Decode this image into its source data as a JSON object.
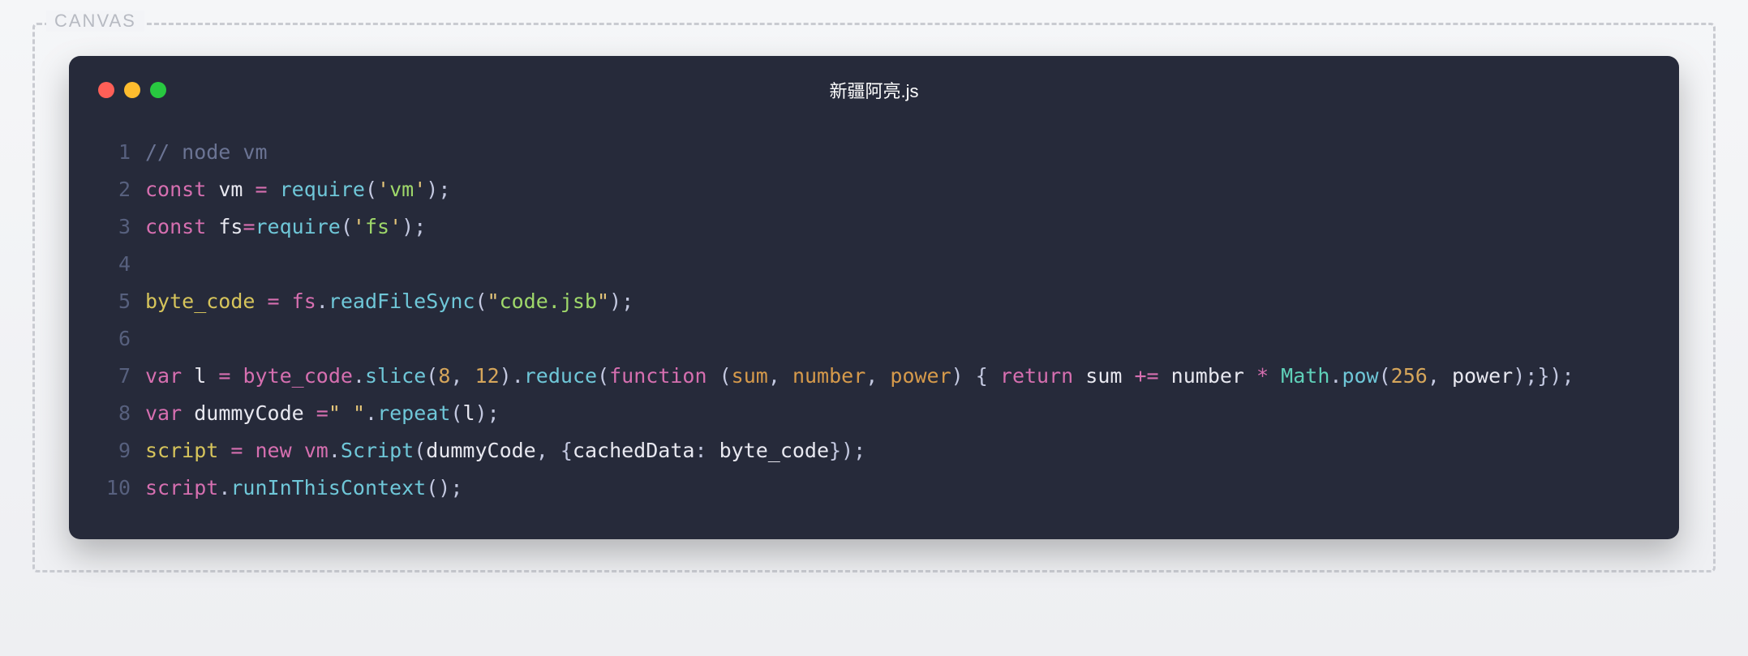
{
  "canvas": {
    "label": "CANVAS"
  },
  "window": {
    "title": "新疆阿亮.js",
    "dots": {
      "red": "#ff5f57",
      "yellow": "#febc2e",
      "green": "#28c840"
    }
  },
  "lineNumbers": [
    "1",
    "2",
    "3",
    "4",
    "5",
    "6",
    "7",
    "8",
    "9",
    "10"
  ],
  "code": {
    "l1": {
      "comment": "// node vm"
    },
    "l2": {
      "kw": "const",
      "sp1": " ",
      "name": "vm",
      "sp2": " ",
      "eq": "=",
      "sp3": " ",
      "fn": "require",
      "lp": "(",
      "q1": "'",
      "str": "vm",
      "q2": "'",
      "rp": ")",
      "semi": ";"
    },
    "l3": {
      "kw": "const",
      "sp1": " ",
      "name": "fs",
      "eq": "=",
      "fn": "require",
      "lp": "(",
      "q1": "'",
      "str": "fs",
      "q2": "'",
      "rp": ")",
      "semi": ";"
    },
    "l5": {
      "lhs": "byte_code",
      "sp1": " ",
      "eq": "=",
      "sp2": " ",
      "obj": "fs",
      "dot": ".",
      "fn": "readFileSync",
      "lp": "(",
      "q1": "\"",
      "str": "code.jsb",
      "q2": "\"",
      "rp": ")",
      "semi": ";"
    },
    "l7": {
      "kw": "var",
      "sp1": " ",
      "name": "l",
      "sp2": " ",
      "eq": "=",
      "sp3": " ",
      "obj": "byte_code",
      "dot1": ".",
      "fn1": "slice",
      "lp1": "(",
      "n1": "8",
      "comma1": ",",
      "sp4": " ",
      "n2": "12",
      "rp1": ")",
      "dot2": ".",
      "fn2": "reduce",
      "lp2": "(",
      "kw2": "function",
      "sp5": " ",
      "lp3": "(",
      "arg1": "sum",
      "comma2": ",",
      "sp6": " ",
      "arg2": "number",
      "comma3": ",",
      "sp7": " ",
      "arg3": "power",
      "rp3": ")",
      "sp8": " ",
      "lb": "{",
      "sp9": " ",
      "kw3": "return",
      "sp10": " ",
      "id1": "sum",
      "sp11": " ",
      "op": "+=",
      "sp12": " ",
      "id2": "number",
      "sp13": " ",
      "mul": "*",
      "sp14": " ",
      "math": "Math",
      "dot3": ".",
      "fn3": "pow",
      "lp4": "(",
      "n3": "256",
      "comma4": ",",
      "sp15": " ",
      "id3": "power",
      "rp4": ")",
      "semi1": ";",
      "rb": "}",
      "rp2": ")",
      "semi2": ";"
    },
    "l8": {
      "kw": "var",
      "sp1": " ",
      "name": "dummyCode",
      "sp2": " ",
      "eq": "=",
      "q1": "\"",
      "str": " ",
      "q2": "\"",
      "dot": ".",
      "fn": "repeat",
      "lp": "(",
      "arg": "l",
      "rp": ")",
      "semi": ";"
    },
    "l9": {
      "lhs": "script",
      "sp1": " ",
      "eq": "=",
      "sp2": " ",
      "kw": "new",
      "sp3": " ",
      "obj": "vm",
      "dot": ".",
      "cls": "Script",
      "lp": "(",
      "arg1": "dummyCode",
      "comma": ",",
      "sp4": " ",
      "lb": "{",
      "key": "cachedData",
      "colon": ":",
      "sp5": " ",
      "val": "byte_code",
      "rb": "}",
      "rp": ")",
      "semi": ";"
    },
    "l10": {
      "obj": "script",
      "dot": ".",
      "fn": "runInThisContext",
      "lp": "(",
      "rp": ")",
      "semi": ";"
    }
  }
}
